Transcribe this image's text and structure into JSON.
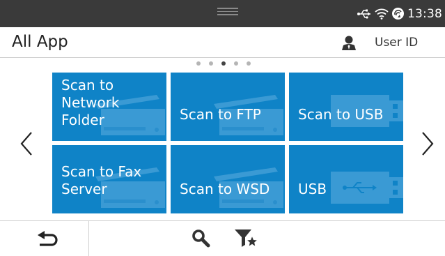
{
  "status_bar": {
    "time": "13:38",
    "icons": [
      "usb-icon",
      "wifi-icon",
      "wifi-direct-icon"
    ]
  },
  "header": {
    "title": "All App",
    "user_label": "User ID"
  },
  "pager": {
    "page_count": 5,
    "current_page": 3
  },
  "tiles": [
    {
      "label": "Scan to Network Folder",
      "icon": "scanner-icon"
    },
    {
      "label": "Scan to FTP",
      "icon": "scanner-icon"
    },
    {
      "label": "Scan to USB",
      "icon": "usb-drive-icon"
    },
    {
      "label": "Scan to Fax Server",
      "icon": "scanner-icon"
    },
    {
      "label": "Scan to WSD",
      "icon": "scanner-icon"
    },
    {
      "label": "USB",
      "icon": "usb-drive-icon"
    }
  ],
  "footer": {
    "icons": [
      "back-icon",
      "search-icon",
      "filter-favorites-icon"
    ]
  },
  "colors": {
    "statusbar": "#3a3a3a",
    "tile": "#0f83c7",
    "tile_text": "#ffffff"
  }
}
